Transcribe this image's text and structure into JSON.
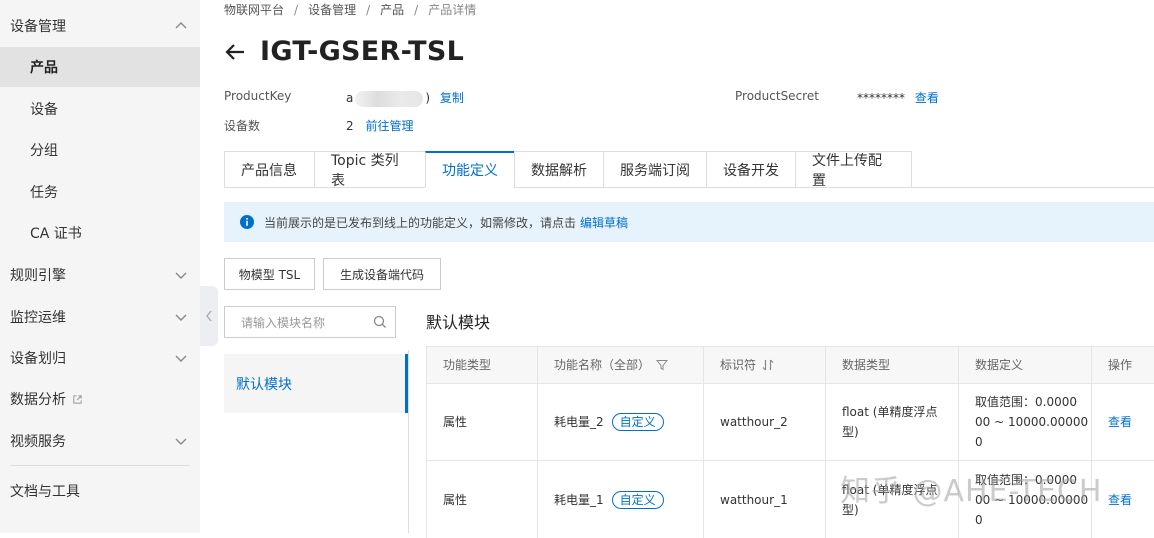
{
  "sidebar": {
    "group_device_mgmt": "设备管理",
    "items": [
      "产品",
      "设备",
      "分组",
      "任务",
      "CA 证书"
    ],
    "group_rules": "规则引擎",
    "group_monitor": "监控运维",
    "group_device_zone": "设备划归",
    "group_analytics": "数据分析",
    "group_video": "视频服务",
    "group_docs": "文档与工具"
  },
  "breadcrumb": [
    "物联网平台",
    "设备管理",
    "产品",
    "产品详情"
  ],
  "header": {
    "title": "IGT-GSER-TSL"
  },
  "meta": {
    "product_key_label": "ProductKey",
    "product_key_prefix": "a",
    "product_key_suffix": ")",
    "copy_link": "复制",
    "product_secret_label": "ProductSecret",
    "product_secret_value": "********",
    "view_link": "查看",
    "device_count_label": "设备数",
    "device_count_value": "2",
    "manage_link": "前往管理"
  },
  "tabs": [
    "产品信息",
    "Topic 类列表",
    "功能定义",
    "数据解析",
    "服务端订阅",
    "设备开发",
    "文件上传配置"
  ],
  "notice": {
    "text": "当前展示的是已发布到线上的功能定义，如需修改，请点击",
    "link": "编辑草稿"
  },
  "buttons": {
    "tsl": "物模型 TSL",
    "gen_code": "生成设备端代码"
  },
  "module_panel": {
    "search_placeholder": "请输入模块名称",
    "module_item": "默认模块"
  },
  "section_title": "默认模块",
  "table": {
    "headers": [
      "功能类型",
      "功能名称（全部）",
      "标识符",
      "数据类型",
      "数据定义",
      "操作"
    ],
    "rows": [
      {
        "type": "属性",
        "name": "耗电量_2",
        "tag": "自定义",
        "identifier": "watthour_2",
        "dtype": [
          "float (单精度浮点",
          "型)"
        ],
        "def": [
          "取值范围：0.0000",
          "00 ~ 10000.00000",
          "0"
        ],
        "action": "查看"
      },
      {
        "type": "属性",
        "name": "耗电量_1",
        "tag": "自定义",
        "identifier": "watthour_1",
        "dtype": [
          "float (单精度浮点",
          "型)"
        ],
        "def": [
          "取值范围：0.0000",
          "00 ~ 10000.00000",
          "0"
        ],
        "action": "查看"
      }
    ]
  },
  "watermark": "知乎 @AHE-TECH",
  "colors": {
    "accent": "#0070cc",
    "notice_bg": "#e6f3fd",
    "sidebar_bg": "#f5f5f5"
  }
}
